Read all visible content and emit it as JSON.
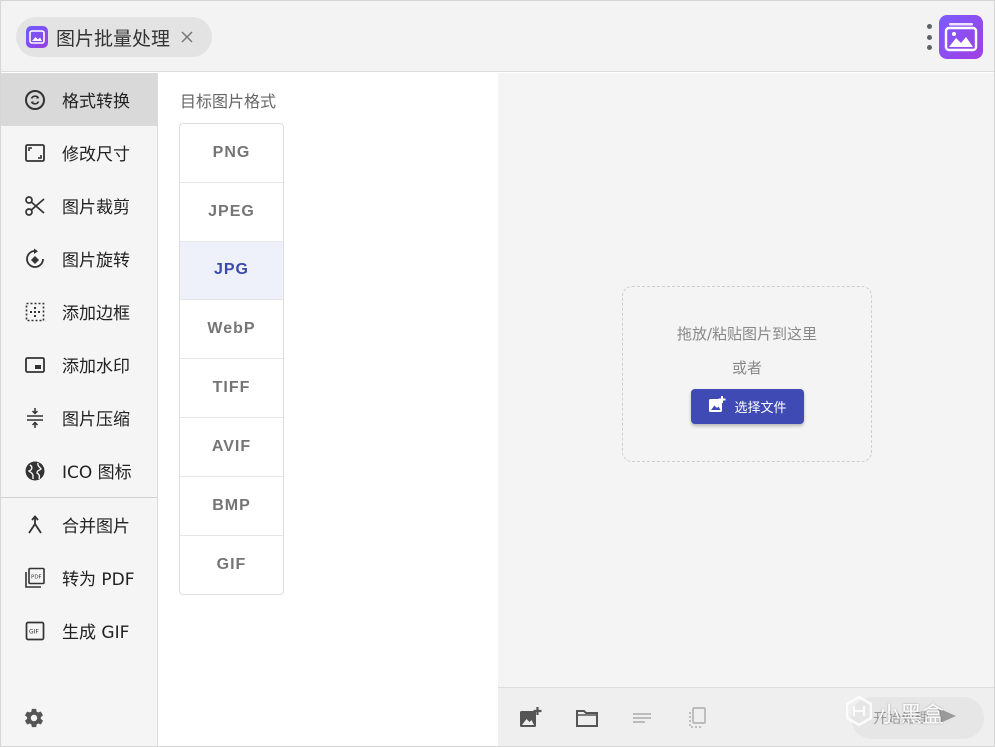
{
  "tab": {
    "title": "图片批量处理"
  },
  "sidebar": {
    "items": [
      {
        "label": "格式转换",
        "icon": "sync-icon",
        "active": true
      },
      {
        "label": "修改尺寸",
        "icon": "resize-icon"
      },
      {
        "label": "图片裁剪",
        "icon": "scissors-icon"
      },
      {
        "label": "图片旋转",
        "icon": "rotate-icon"
      },
      {
        "label": "添加边框",
        "icon": "border-icon"
      },
      {
        "label": "添加水印",
        "icon": "watermark-icon"
      },
      {
        "label": "图片压缩",
        "icon": "compress-icon"
      },
      {
        "label": "ICO 图标",
        "icon": "globe-icon"
      }
    ],
    "items2": [
      {
        "label": "合并图片",
        "icon": "merge-icon"
      },
      {
        "label": "转为 PDF",
        "icon": "pdf-icon"
      },
      {
        "label": "生成 GIF",
        "icon": "gif-icon"
      }
    ]
  },
  "format_panel": {
    "title": "目标图片格式",
    "formats": [
      "PNG",
      "JPEG",
      "JPG",
      "WebP",
      "TIFF",
      "AVIF",
      "BMP",
      "GIF"
    ],
    "selected": "JPG"
  },
  "drop_zone": {
    "hint": "拖放/粘贴图片到这里",
    "or": "或者",
    "button": "选择文件"
  },
  "toolbar": {
    "process_label": "开始处理"
  },
  "watermark": {
    "text": "小黑盒"
  },
  "colors": {
    "accent": "#3f4ab5",
    "selected_bg": "#eef0fa",
    "logo": "#8a4ef0"
  }
}
